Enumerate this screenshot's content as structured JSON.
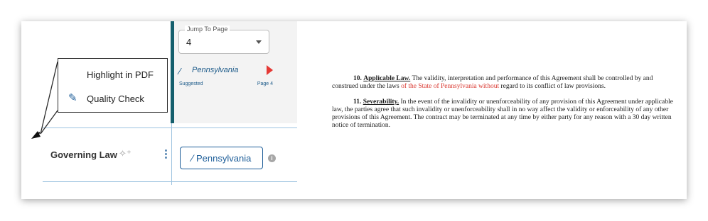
{
  "jump_to_page": {
    "legend": "Jump To Page",
    "value": "4"
  },
  "suggestion": {
    "value": "Pennsylvania",
    "label": "Suggested",
    "page": "Page 4"
  },
  "menu": {
    "items": [
      {
        "label": "Highlight in PDF",
        "icon": "pdf-icon"
      },
      {
        "label": "Quality Check",
        "icon": "pencil-icon"
      }
    ]
  },
  "field": {
    "label": "Governing Law",
    "value": "Pennsylvania"
  },
  "colors": {
    "accent": "#1e5e99",
    "teal": "#155f6d",
    "highlight_red": "#d9362e",
    "suggestion_arrow": "#e53935"
  },
  "document": {
    "p10": {
      "number": "10.",
      "heading": "Applicable Law.",
      "text_a": " The validity, interpretation and performance of this Agreement shall be controlled by and construed under the laws ",
      "highlight": "of the State of Pennsylvania without",
      "text_b": " regard to its conflict of law provisions."
    },
    "p11": {
      "number": "11.",
      "heading": "Severability.",
      "text": " In the event of the invalidity or unenforceability of any provision of this Agreement under applicable law, the parties agree that such invalidity or unenforceability shall in no way affect the validity or enforceability of any other provisions of this Agreement. The contract may be terminated at any time by either party for any reason with a 30 day written notice of termination."
    }
  }
}
